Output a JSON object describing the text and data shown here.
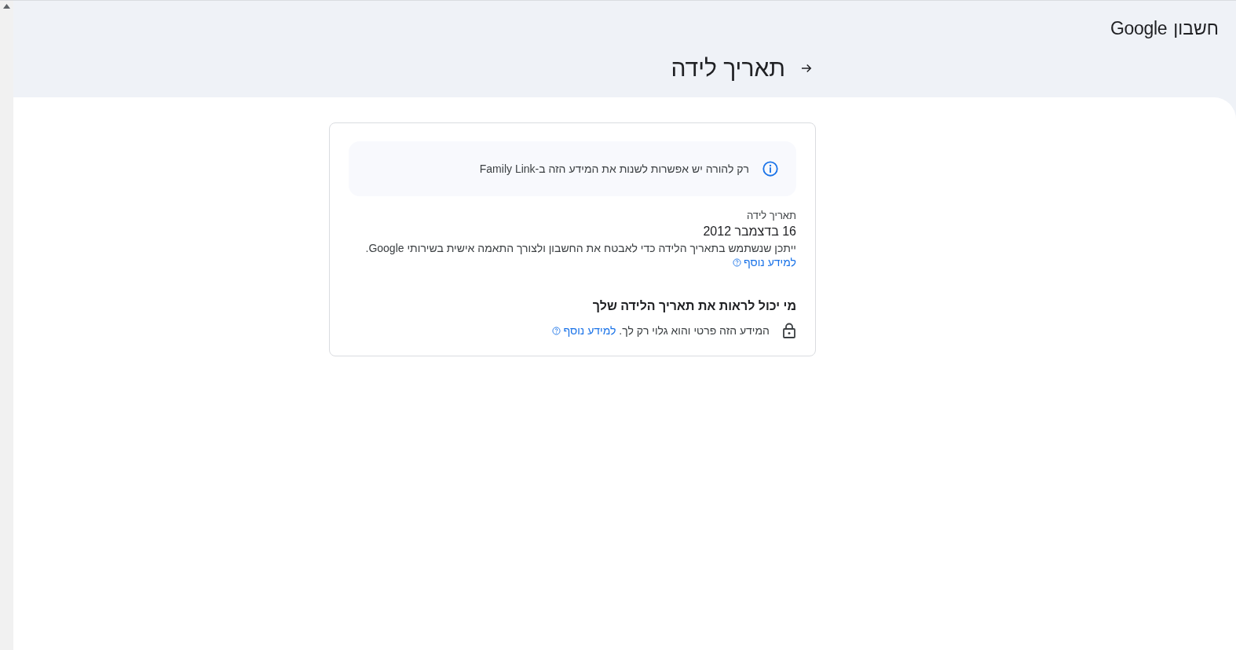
{
  "header": {
    "logo": "Google",
    "product": "חשבון",
    "title": "תאריך לידה"
  },
  "notice": {
    "text": "רק להורה יש אפשרות לשנות את המידע הזה ב-Family Link"
  },
  "field": {
    "label": "תאריך לידה",
    "value": "16 בדצמבר 2012",
    "description": "ייתכן שנשתמש בתאריך הלידה כדי לאבטח את החשבון ולצורך התאמה אישית בשירותי Google.",
    "link": "למידע נוסף"
  },
  "visibility": {
    "heading": "מי יכול לראות את תאריך הלידה שלך",
    "text": "המידע הזה פרטי והוא גלוי רק לך.",
    "link": "למידע נוסף"
  }
}
